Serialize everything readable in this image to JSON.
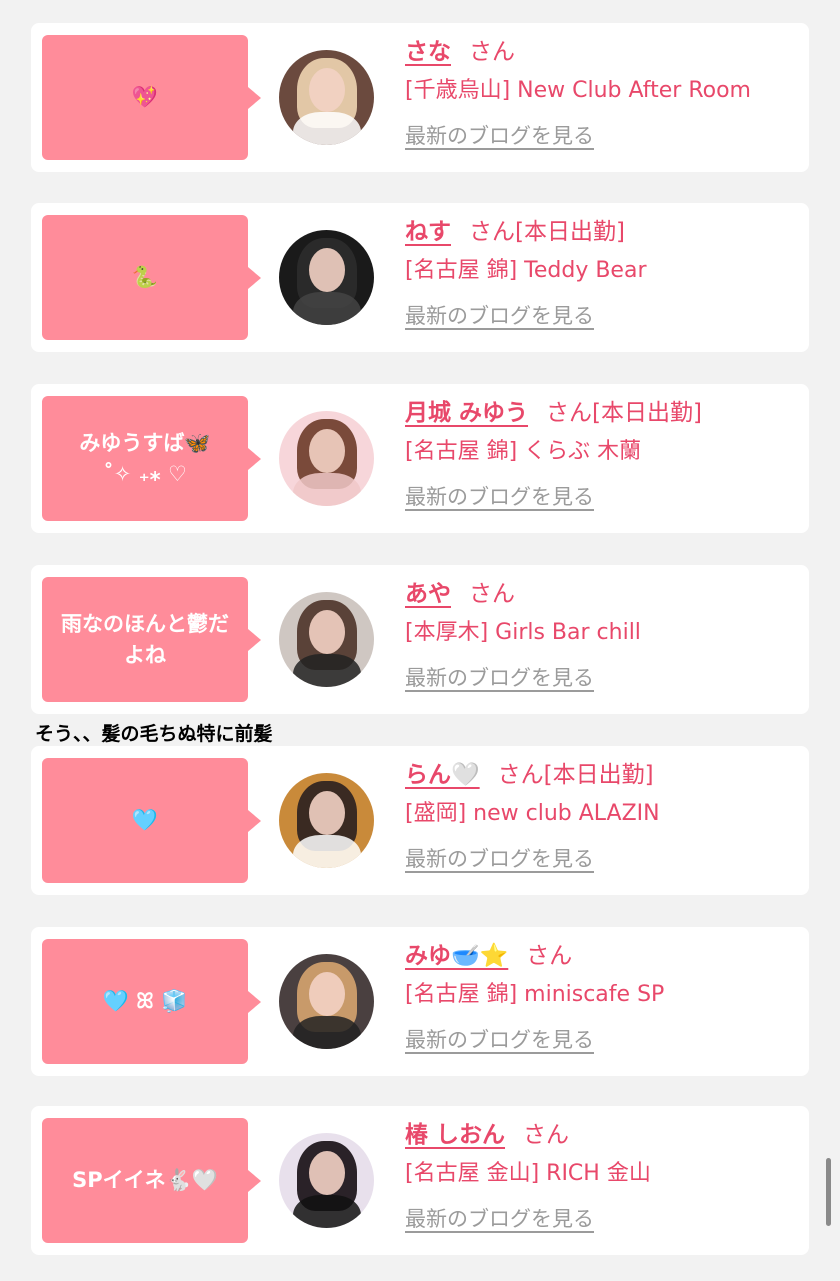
{
  "colors": {
    "accent": "#e8486a",
    "bubble": "#ff8c9a",
    "link_gray": "#9b9b9b",
    "card_bg": "#ffffff",
    "page_bg": "#f2f2f2"
  },
  "blog_link_label": "最新のブログを見る",
  "caption": "そう、、髪の毛ちぬ特に前髪",
  "cards": [
    {
      "message": "💖",
      "name": "さな",
      "suffix": "さん",
      "status": "",
      "shop": "[千歳烏山] New Club After Room",
      "avatar_tone": "#6b4a3e",
      "hair_tone": "#e2c7a6"
    },
    {
      "message": "🐍",
      "name": "ねす",
      "suffix": "さん",
      "status": "[本日出勤]",
      "shop": "[名古屋 錦] Teddy Bear",
      "avatar_tone": "#1a1a1a",
      "hair_tone": "#2a2a2a"
    },
    {
      "message": "みゆうすば🦋\n˚✧ ₊⁎ ♡",
      "name": "月城 みゆう",
      "suffix": "さん",
      "status": "[本日出勤]",
      "shop": "[名古屋 錦] くらぶ 木蘭",
      "avatar_tone": "#f7d6da",
      "hair_tone": "#7a4a3a"
    },
    {
      "message": "雨なのほんと鬱だよね",
      "name": "あや",
      "suffix": "さん",
      "status": "",
      "shop": "[本厚木] Girls Bar chill",
      "avatar_tone": "#cfc7c2",
      "hair_tone": "#5a4238"
    },
    {
      "message": "🩵",
      "name": "らん🤍",
      "suffix": "さん",
      "status": "[本日出勤]",
      "shop": "[盛岡] new club ALAZIN",
      "avatar_tone": "#c98a3a",
      "hair_tone": "#3a2a22"
    },
    {
      "message": "🩵 ꕤ 🧊",
      "name": "みゆ🥣⭐",
      "suffix": "さん",
      "status": "",
      "shop": "[名古屋 錦] miniscafe SP",
      "avatar_tone": "#4a4040",
      "hair_tone": "#c89a6a"
    },
    {
      "message": "SPイイネ🐇🤍",
      "name": "椿 しおん",
      "suffix": "さん",
      "status": "",
      "shop": "[名古屋 金山] RICH 金山",
      "avatar_tone": "#e8e0ec",
      "hair_tone": "#2a2228"
    }
  ]
}
